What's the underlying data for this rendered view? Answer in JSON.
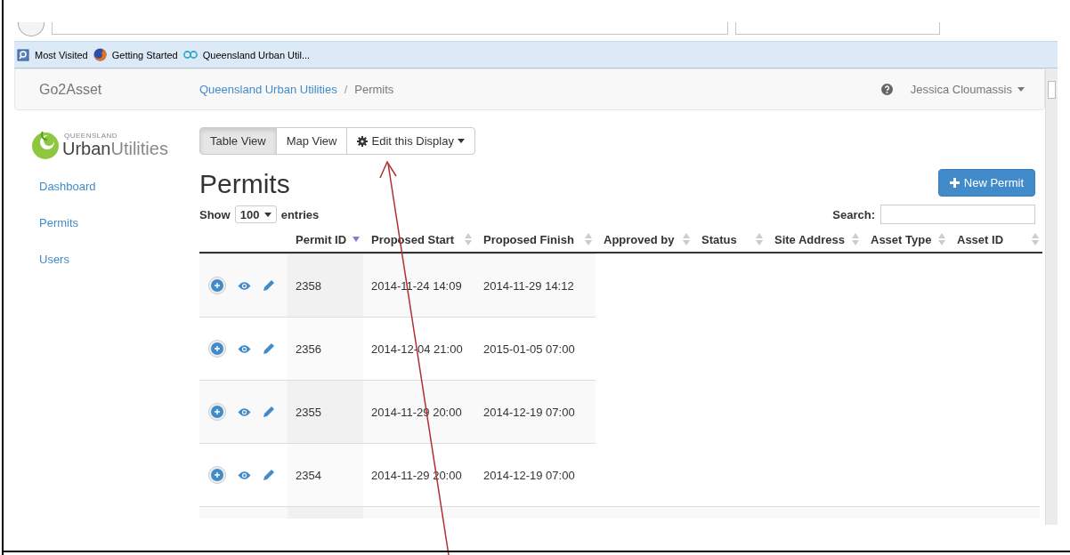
{
  "bookmarks": [
    {
      "label": "Most Visited",
      "kind": "search"
    },
    {
      "label": "Getting Started",
      "kind": "firefox"
    },
    {
      "label": "Queensland Urban Util...",
      "kind": "go"
    }
  ],
  "navbar": {
    "brand": "Go2Asset",
    "breadcrumb": [
      "Queensland Urban Utilities",
      "Permits"
    ],
    "separator": "/",
    "user": "Jessica Cloumassis"
  },
  "logo": {
    "small": "QUEENSLAND",
    "main_1": "Urban",
    "main_2": "Utilities"
  },
  "sidebar": {
    "items": [
      {
        "label": "Dashboard"
      },
      {
        "label": "Permits"
      },
      {
        "label": "Users"
      }
    ]
  },
  "view_tabs": [
    {
      "label": "Table View",
      "selected": true
    },
    {
      "label": "Map View",
      "selected": false
    }
  ],
  "edit_button": "Edit this Display",
  "title": "Permits",
  "new_button": "New Permit",
  "length": {
    "show": "Show",
    "value": "100",
    "entries": "entries"
  },
  "search": {
    "label": "Search:"
  },
  "table": {
    "columns": [
      {
        "label": "Permit ID",
        "sorted": true
      },
      {
        "label": "Proposed Start",
        "sorted": false
      },
      {
        "label": "Proposed Finish",
        "sorted": false
      },
      {
        "label": "Approved by",
        "sorted": false
      },
      {
        "label": "Status",
        "sorted": false
      },
      {
        "label": "Site Address",
        "sorted": false
      },
      {
        "label": "Asset Type",
        "sorted": false
      },
      {
        "label": "Asset ID",
        "sorted": false
      }
    ],
    "rows": [
      {
        "cells": [
          "2358",
          "2014-11-24 14:09",
          "2014-11-29 14:12"
        ]
      },
      {
        "cells": [
          "2356",
          "2014-12-04 21:00",
          "2015-01-05 07:00"
        ]
      },
      {
        "cells": [
          "2355",
          "2014-11-29 20:00",
          "2014-12-19 07:00"
        ]
      },
      {
        "cells": [
          "2354",
          "2014-11-29 20:00",
          "2014-12-19 07:00"
        ]
      }
    ]
  }
}
